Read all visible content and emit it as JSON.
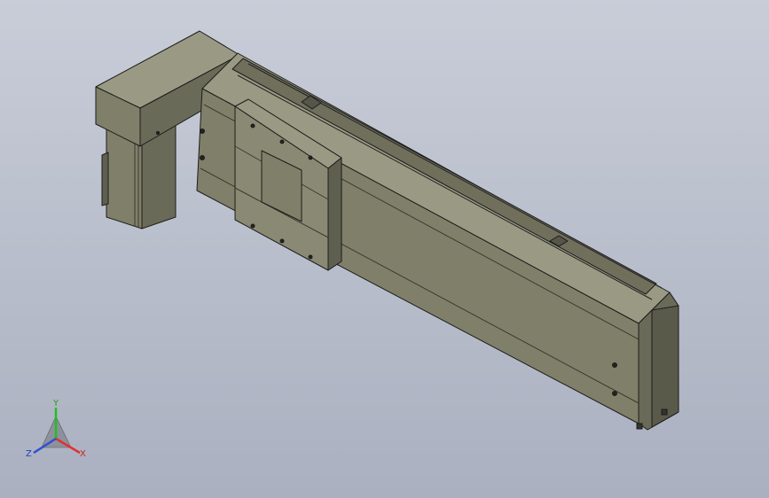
{
  "viewport": {
    "background_top": "#c9cdd8",
    "background_bottom": "#aab0c0"
  },
  "model": {
    "body_color": "#80806a",
    "body_dark": "#5f5f4f",
    "body_light": "#9a9a84",
    "edge_color": "#1c1c1c"
  },
  "triad": {
    "x_label": "X",
    "y_label": "Y",
    "z_label": "Z",
    "x_color": "#e03030",
    "y_color": "#20c020",
    "z_color": "#3050d0"
  }
}
